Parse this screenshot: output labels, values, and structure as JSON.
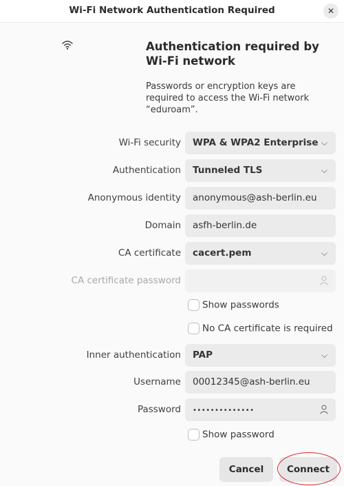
{
  "window": {
    "title": "Wi-Fi Network Authentication Required",
    "close_symbol": "✕"
  },
  "header": {
    "icon": "wifi-icon",
    "heading": "Authentication required by Wi-Fi network",
    "description": "Passwords or encryption keys are required to access the Wi-Fi network “eduroam”."
  },
  "form": {
    "wifi_security": {
      "label": "Wi-Fi security",
      "value": "WPA & WPA2 Enterprise"
    },
    "authentication": {
      "label": "Authentication",
      "value": "Tunneled TLS"
    },
    "anonymous_identity": {
      "label": "Anonymous identity",
      "value": "anonymous@ash-berlin.eu"
    },
    "domain": {
      "label": "Domain",
      "value": "asfh-berlin.de"
    },
    "ca_certificate": {
      "label": "CA certificate",
      "value": "cacert.pem"
    },
    "ca_certificate_password": {
      "label": "CA certificate password",
      "value": ""
    },
    "show_passwords": {
      "label": "Show passwords",
      "checked": false
    },
    "no_ca_required": {
      "label": "No CA certificate is required",
      "checked": false
    },
    "inner_authentication": {
      "label": "Inner authentication",
      "value": "PAP"
    },
    "username": {
      "label": "Username",
      "value": "00012345@ash-berlin.eu"
    },
    "password": {
      "label": "Password",
      "value": "••••••••••••••"
    },
    "show_password": {
      "label": "Show password",
      "checked": false
    },
    "dropdown_symbol": "⌵"
  },
  "buttons": {
    "cancel": "Cancel",
    "connect": "Connect"
  },
  "colors": {
    "field_bg": "#ebebeb",
    "highlight": "#d6282a"
  }
}
